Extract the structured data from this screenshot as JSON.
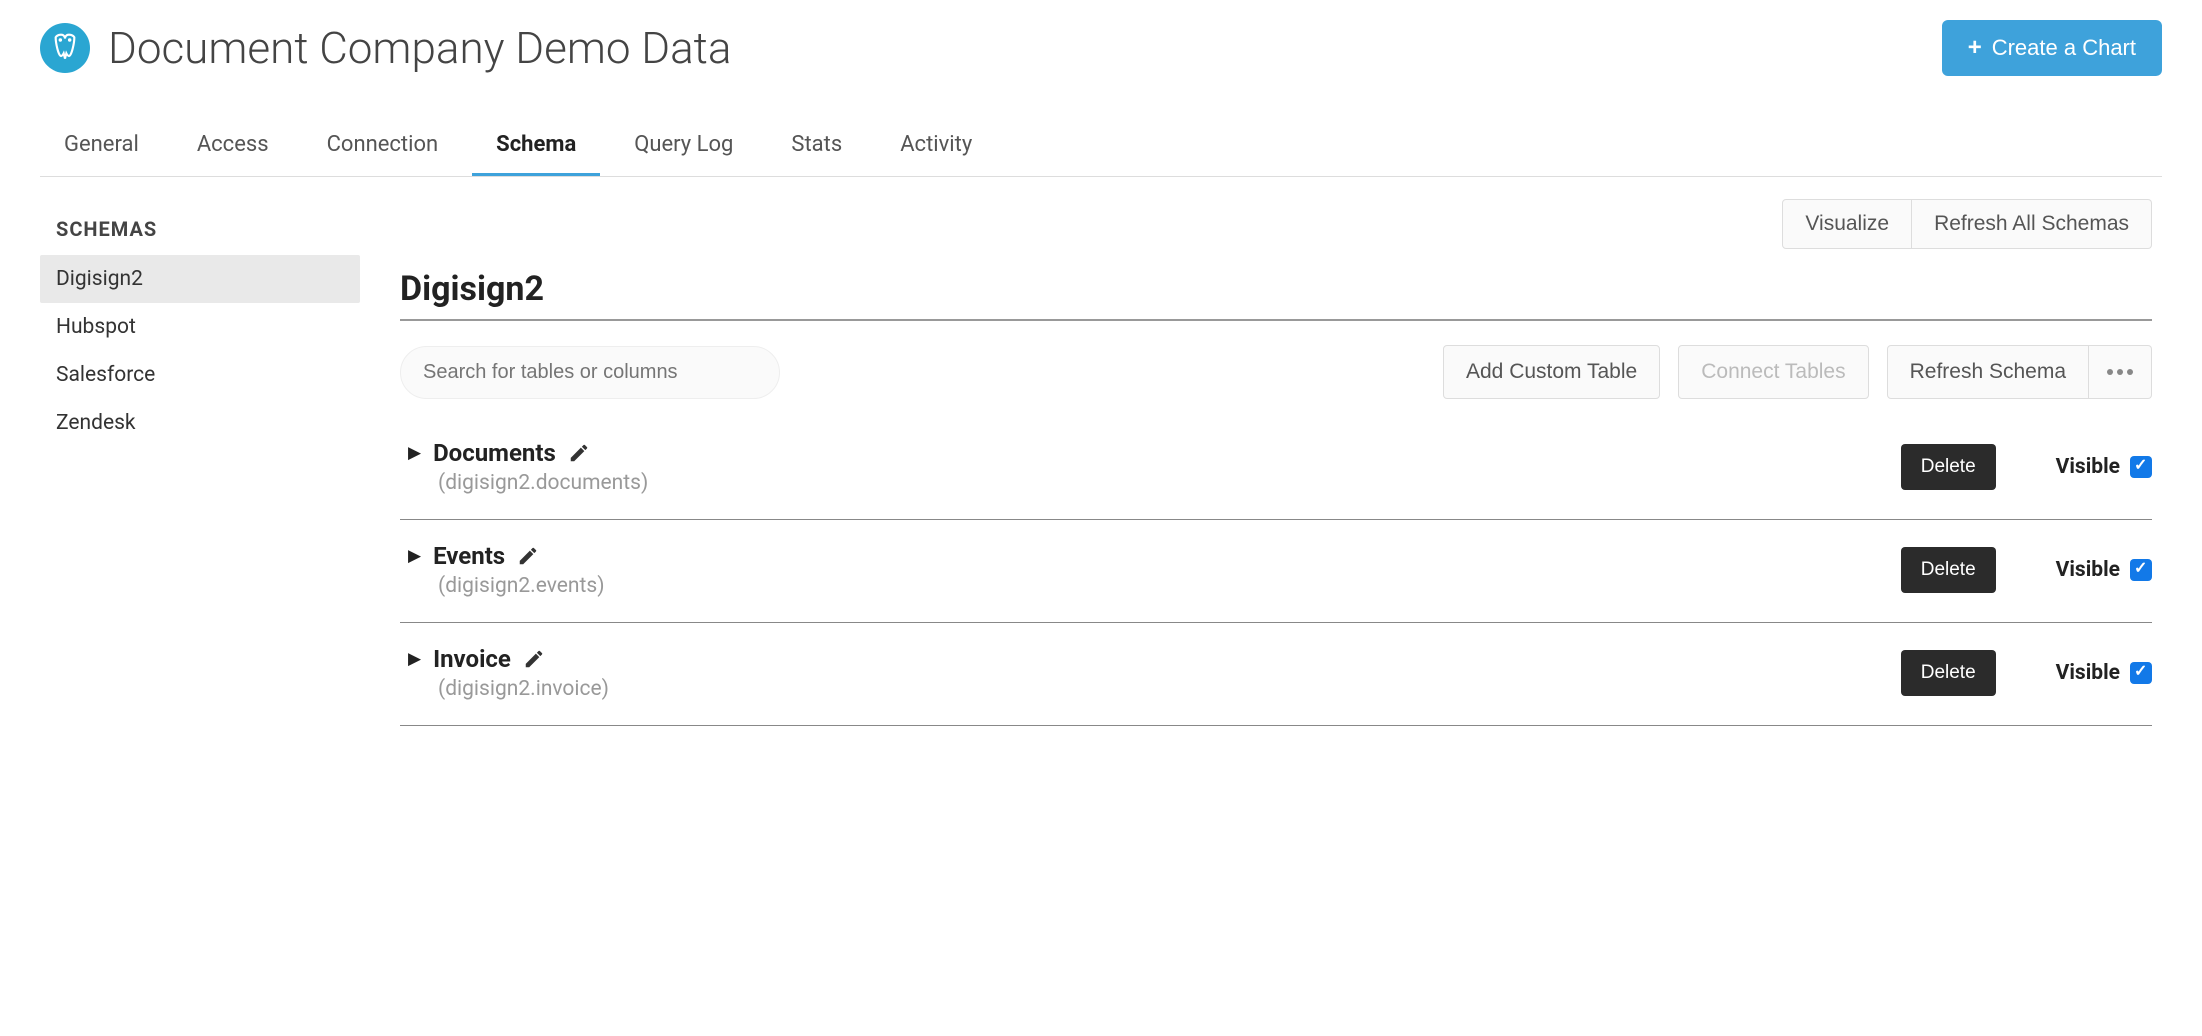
{
  "header": {
    "title": "Document Company Demo Data",
    "create_label": "Create a Chart"
  },
  "tabs": [
    "General",
    "Access",
    "Connection",
    "Schema",
    "Query Log",
    "Stats",
    "Activity"
  ],
  "active_tab": "Schema",
  "sidebar": {
    "title": "SCHEMAS",
    "items": [
      "Digisign2",
      "Hubspot",
      "Salesforce",
      "Zendesk"
    ],
    "active": "Digisign2"
  },
  "top_actions": {
    "visualize": "Visualize",
    "refresh_all": "Refresh All Schemas"
  },
  "main": {
    "title": "Digisign2",
    "search_placeholder": "Search for tables or columns",
    "toolbar": {
      "add_custom": "Add Custom Table",
      "connect": "Connect Tables",
      "refresh": "Refresh Schema"
    },
    "tables": [
      {
        "name": "Documents",
        "path": "(digisign2.documents)",
        "delete": "Delete",
        "visible_label": "Visible",
        "visible": true
      },
      {
        "name": "Events",
        "path": "(digisign2.events)",
        "delete": "Delete",
        "visible_label": "Visible",
        "visible": true
      },
      {
        "name": "Invoice",
        "path": "(digisign2.invoice)",
        "delete": "Delete",
        "visible_label": "Visible",
        "visible": true
      }
    ]
  }
}
